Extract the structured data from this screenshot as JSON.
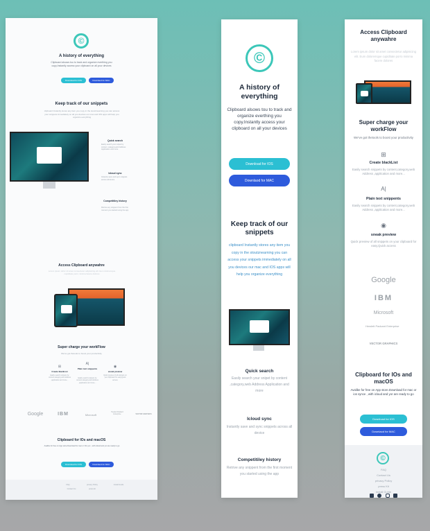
{
  "brand_color": "#3cc7b9",
  "ios_color": "#2bbfd3",
  "mac_color": "#2e5bdc",
  "hero": {
    "title": "A history of everything",
    "subtitle": "Clipboard alsows tou to track and organize everthing you copy.Instantly access your clipboard on all your devices",
    "ios_button": "Download for IOS",
    "mac_button": "Downlaod for MAC"
  },
  "track": {
    "title": "Keep track of our snippets",
    "body": "clipboard Instantly stores any item you copy in the stoutznearning you can access your snippets immediately on all you devices our mac and IOS apps will help you organize everything",
    "features": [
      {
        "title": "Quick search",
        "body": "Easily search your snipet by content ,category,web Address Application and more"
      },
      {
        "title": "Icloud sync",
        "body": "Instantly save and sync snippets across all device"
      },
      {
        "title": "Competitiley history",
        "body": "Retrive any snippent from the first moment you started using the app"
      }
    ]
  },
  "access": {
    "title": "Access Clipboard anywahre",
    "body": "Lorem ipsum dolor sit amet consectetur adipisicing elit. Eum doloremque cupiditate porro minima facere dolores"
  },
  "super": {
    "title": "Super charge your workFlow",
    "subtitle": "We've got thetools to boost your productivity",
    "items": [
      {
        "icon": "blacklist-icon",
        "glyph": "⊞",
        "title": "Create blackList",
        "body": "Easily search snippets by content,category,web Address ,application and more..."
      },
      {
        "icon": "text-icon",
        "glyph": "A|",
        "title": "Plain text snippents",
        "body": "Easily search snippets by content,category,web Address ,application and more..."
      },
      {
        "icon": "eye-icon",
        "glyph": "◉",
        "title": "sneak preview",
        "body": "Quick preview of all snippets on your clipboard for easy,Quick access"
      }
    ]
  },
  "brands": [
    "Google",
    "IBM",
    "Microsoft",
    "Hewlett Packard Enterprise",
    "VECTOR GRAPHICS"
  ],
  "brands_f3": [
    "Google",
    "IBM",
    "Microsoft",
    "Hewlett Packard Enterprise",
    "VECTOR GRAPHICS"
  ],
  "cta": {
    "title": "Clipboard for IOs and macOS",
    "body": "Avalibe for free on App store.Download for mac or IOs ync , with icloud and yor are ready to go",
    "body_f3": "Avalibe for free on App store.Download for mac or ios synce , with icloud and yor are ready to go",
    "ios_button": "Download for IOS",
    "mac_button": "Downlaod for MAC"
  },
  "footer": {
    "links": [
      "FAQ",
      "Contact Us",
      "privacy Policy",
      "press Kit",
      "Install Guide"
    ],
    "socials": [
      "facebook-icon",
      "twitter-icon",
      "instagram-icon",
      "facebook-icon"
    ],
    "f1_links": [
      "FAQ",
      "privacy Policy",
      "Install Guide",
      "Contact Us",
      "press kit"
    ]
  },
  "frame3_access": {
    "title": "Access Clipboard anywahre",
    "body": "Lorem ipsum dolor sit amet consectetur adipisicing elit. Eum doloremque cupiditate porro minima facere dolores"
  },
  "frame3_super": {
    "title": "Super charge your workFlow",
    "subtitle": "We've got thetools to boost your productivity"
  }
}
